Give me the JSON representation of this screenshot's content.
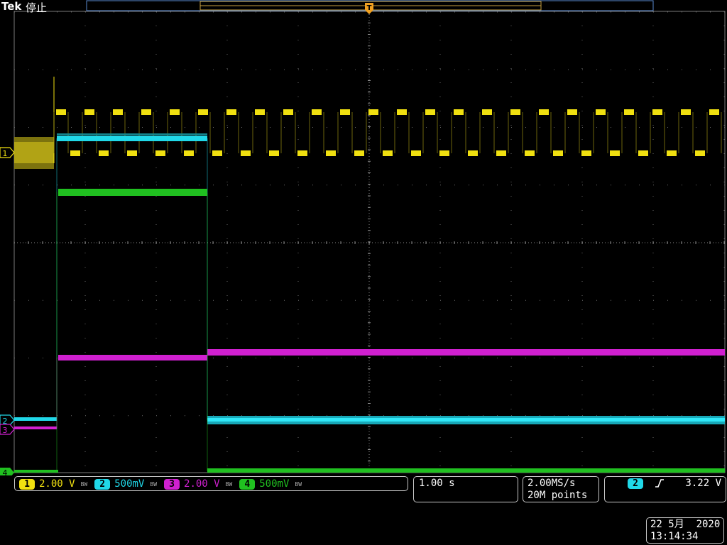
{
  "header": {
    "brand": "Tek",
    "run_state": "停止"
  },
  "markers": {
    "ch1": "1",
    "ch2": "2",
    "ch3": "3",
    "ch4": "4",
    "trigger_position_glyph": "T"
  },
  "channels": [
    {
      "number": "1",
      "scale": "2.00 V",
      "color": "#f0e010",
      "bandwidth_glyph": "BW"
    },
    {
      "number": "2",
      "scale": "500mV",
      "color": "#20d8e8",
      "bandwidth_glyph": "BW"
    },
    {
      "number": "3",
      "scale": "2.00 V",
      "color": "#d020d0",
      "bandwidth_glyph": "BW"
    },
    {
      "number": "4",
      "scale": "500mV",
      "color": "#20c020",
      "bandwidth_glyph": "BW"
    }
  ],
  "timebase": {
    "scale": "1.00 s"
  },
  "acquisition": {
    "sample_rate": "2.00MS/s",
    "record_length": "20M points"
  },
  "trigger": {
    "source": "2",
    "slope_icon": "rising-edge-icon",
    "level": "3.22 V"
  },
  "datetime": {
    "date": "22 5月  2020",
    "time": "13:14:34"
  },
  "colors": {
    "ch1": "#f0e010",
    "ch2": "#20d8e8",
    "ch3": "#d020d0",
    "ch4": "#20c020",
    "grid": "#7a7a7a",
    "record_bar": "#5a8ad0",
    "trigger_marker": "#f0a020"
  }
}
